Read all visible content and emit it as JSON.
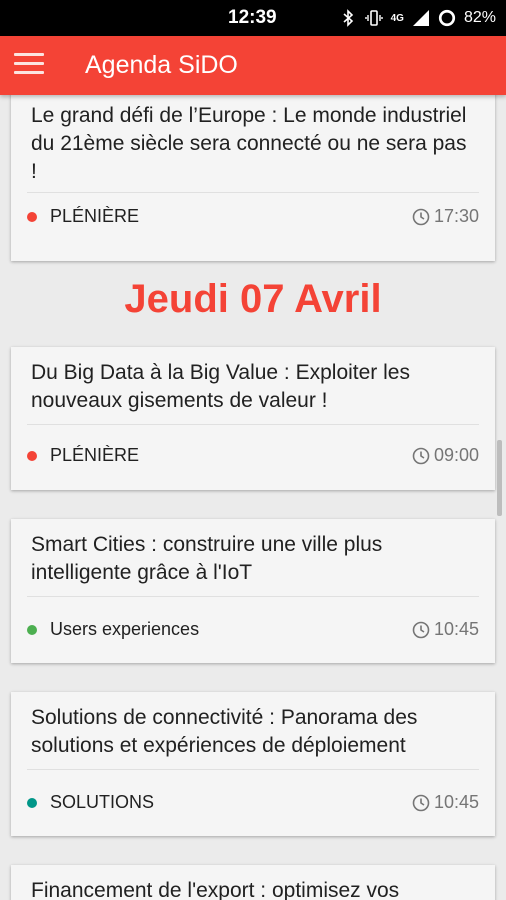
{
  "status_bar": {
    "time": "12:39",
    "network": "4G",
    "battery": "82%"
  },
  "app_bar": {
    "title": "Agenda SiDO"
  },
  "day_header": "Jeudi 07 Avril",
  "sessions": [
    {
      "title": "Le grand défi de l’Europe : Le monde industriel du 21ème siècle sera connecté ou ne sera pas !",
      "category": "PLÉNIÈRE",
      "category_color": "#f44336",
      "time": "17:30"
    },
    {
      "title": "Du Big Data à la Big Value : Exploiter les nouveaux gisements de valeur !",
      "category": "PLÉNIÈRE",
      "category_color": "#f44336",
      "time": "09:00"
    },
    {
      "title": "Smart Cities : construire une ville plus intelligente grâce à l'IoT",
      "category": "Users experiences",
      "category_color": "#4caf50",
      "time": "10:45"
    },
    {
      "title": "Solutions de connectivité : Panorama des solutions et expériences de déploiement",
      "category": "SOLUTIONS",
      "category_color": "#009688",
      "time": "10:45"
    },
    {
      "title": "Financement de l'export : optimisez vos"
    }
  ],
  "colors": {
    "accent": "#f44336",
    "status_bar": "#000000"
  }
}
